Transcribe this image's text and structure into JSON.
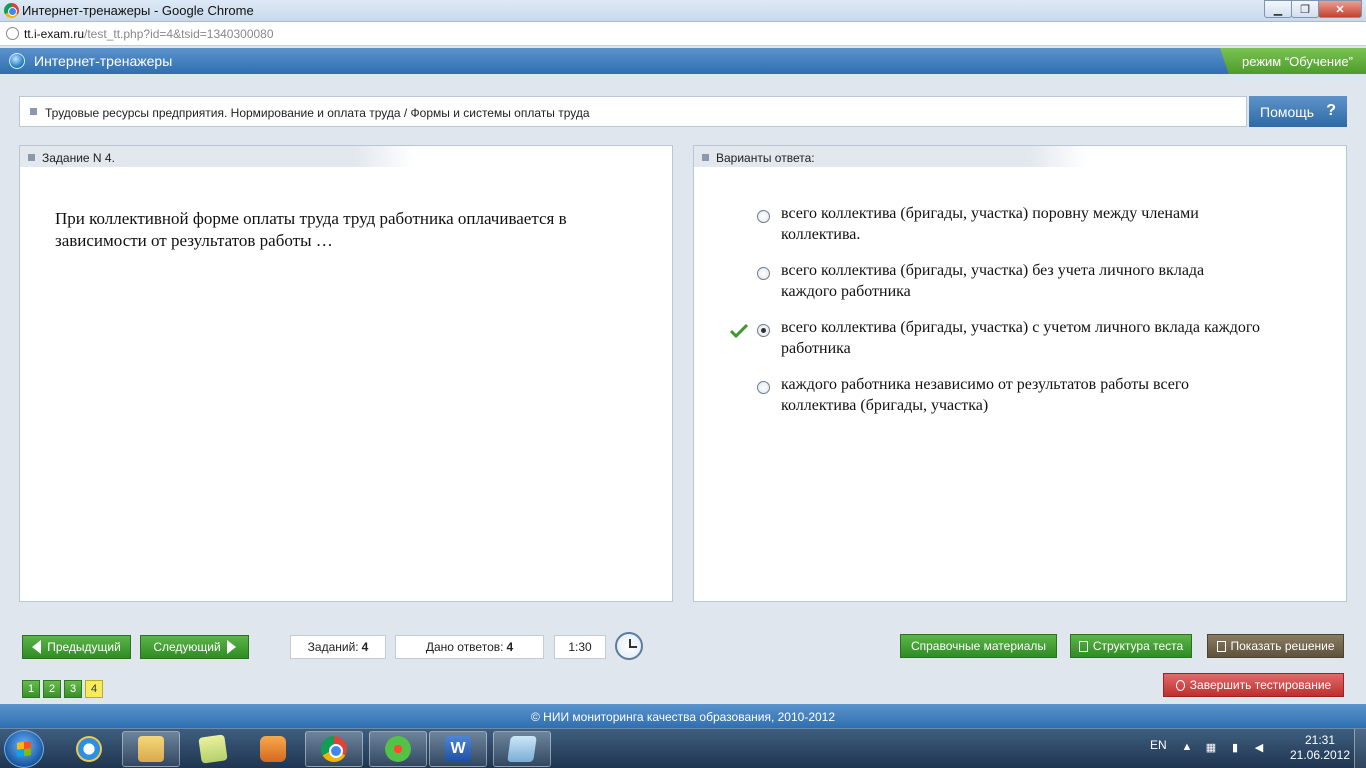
{
  "window": {
    "title": "Интернет-тренажеры - Google Chrome",
    "minimize": "▁",
    "maximize": "❐",
    "close": "✕"
  },
  "address": {
    "url_host": "tt.i-exam.ru",
    "url_path": "/test_tt.php?id=4&tsid=1340300080"
  },
  "header": {
    "title": "Интернет-тренажеры",
    "mode": "режим “Обучение”"
  },
  "breadcrumb": {
    "text": "Трудовые ресурсы предприятия. Нормирование и оплата труда / Формы и системы оплаты труда",
    "help": "Помощь",
    "help_icon": "?"
  },
  "task": {
    "heading": "Задание N 4.",
    "question": "При коллективной форме оплаты труда труд работника оплачивается в зависимости от результатов работы …"
  },
  "answers": {
    "heading": "Варианты ответа:",
    "options": [
      {
        "text": "всего коллектива (бригады, участка) поровну между членами коллектива.",
        "selected": false,
        "correct": false
      },
      {
        "text": "всего коллектива (бригады, участка) без учета личного вклада каждого работника",
        "selected": false,
        "correct": false
      },
      {
        "text": "всего коллектива (бригады, участка) с учетом личного вклада каждого работника",
        "selected": true,
        "correct": true
      },
      {
        "text": "каждого работника независимо от результатов работы всего коллектива (бригады, участка)",
        "selected": false,
        "correct": false
      }
    ]
  },
  "controls": {
    "prev": "Предыдущий",
    "next": "Следующий",
    "tasks_label": "Заданий:",
    "tasks_count": "4",
    "answered_label": "Дано ответов:",
    "answered_count": "4",
    "timer": "1:30",
    "reference": "Справочные материалы",
    "structure": "Структура теста",
    "show_solution": "Показать решение",
    "finish": "Завершить тестирование",
    "pages": [
      "1",
      "2",
      "3",
      "4"
    ],
    "current_page": "4"
  },
  "footer": {
    "text": "© НИИ мониторинга качества образования, 2010-2012"
  },
  "taskbar": {
    "lang": "EN",
    "time": "21:31",
    "date": "21.06.2012",
    "word_letter": "W"
  },
  "colors": {
    "accent_blue": "#2f6fb0",
    "green": "#3a9029",
    "check_green": "#3e9a2b",
    "red": "#bf2f2f",
    "current_page": "#f5ec5b"
  }
}
